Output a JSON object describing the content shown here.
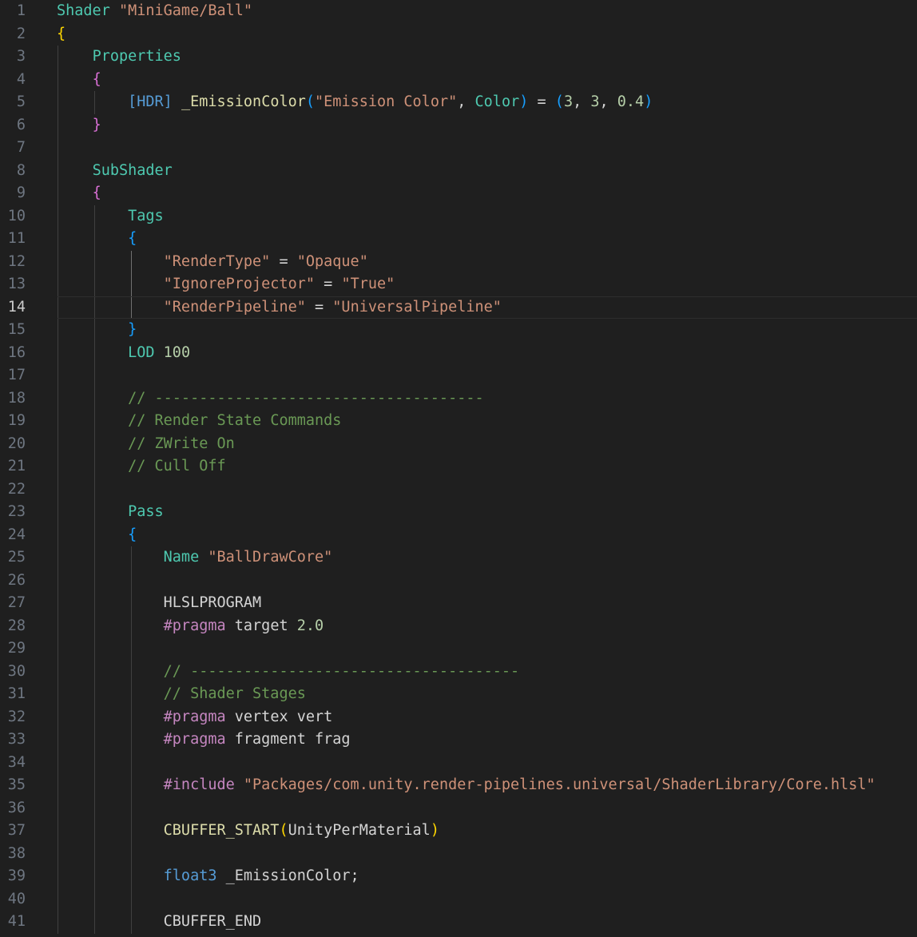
{
  "editor": {
    "language": "shaderlab",
    "current_line": 14,
    "lines": [
      {
        "n": "1",
        "tokens": [
          {
            "c": "kw",
            "t": "Shader"
          },
          {
            "c": "plain",
            "t": " "
          },
          {
            "c": "str",
            "t": "\"MiniGame/Ball\""
          }
        ]
      },
      {
        "n": "2",
        "tokens": [
          {
            "c": "b1",
            "t": "{"
          }
        ]
      },
      {
        "n": "3",
        "tokens": [
          {
            "c": "plain",
            "t": "    "
          },
          {
            "c": "kw",
            "t": "Properties"
          }
        ]
      },
      {
        "n": "4",
        "tokens": [
          {
            "c": "plain",
            "t": "    "
          },
          {
            "c": "b2",
            "t": "{"
          }
        ]
      },
      {
        "n": "5",
        "tokens": [
          {
            "c": "plain",
            "t": "        "
          },
          {
            "c": "type",
            "t": "[HDR]"
          },
          {
            "c": "plain",
            "t": " "
          },
          {
            "c": "prop",
            "t": "_EmissionColor"
          },
          {
            "c": "b3",
            "t": "("
          },
          {
            "c": "str",
            "t": "\"Emission Color\""
          },
          {
            "c": "plain",
            "t": ", "
          },
          {
            "c": "kw",
            "t": "Color"
          },
          {
            "c": "b3",
            "t": ")"
          },
          {
            "c": "plain",
            "t": " = "
          },
          {
            "c": "b3",
            "t": "("
          },
          {
            "c": "num",
            "t": "3"
          },
          {
            "c": "plain",
            "t": ", "
          },
          {
            "c": "num",
            "t": "3"
          },
          {
            "c": "plain",
            "t": ", "
          },
          {
            "c": "num",
            "t": "0.4"
          },
          {
            "c": "b3",
            "t": ")"
          }
        ]
      },
      {
        "n": "6",
        "tokens": [
          {
            "c": "plain",
            "t": "    "
          },
          {
            "c": "b2",
            "t": "}"
          }
        ]
      },
      {
        "n": "7",
        "tokens": []
      },
      {
        "n": "8",
        "tokens": [
          {
            "c": "plain",
            "t": "    "
          },
          {
            "c": "kw",
            "t": "SubShader"
          }
        ]
      },
      {
        "n": "9",
        "tokens": [
          {
            "c": "plain",
            "t": "    "
          },
          {
            "c": "b2",
            "t": "{"
          }
        ]
      },
      {
        "n": "10",
        "tokens": [
          {
            "c": "plain",
            "t": "        "
          },
          {
            "c": "kw",
            "t": "Tags"
          }
        ]
      },
      {
        "n": "11",
        "tokens": [
          {
            "c": "plain",
            "t": "        "
          },
          {
            "c": "b3",
            "t": "{"
          }
        ]
      },
      {
        "n": "12",
        "tokens": [
          {
            "c": "plain",
            "t": "            "
          },
          {
            "c": "str",
            "t": "\"RenderType\""
          },
          {
            "c": "plain",
            "t": " = "
          },
          {
            "c": "str",
            "t": "\"Opaque\""
          }
        ]
      },
      {
        "n": "13",
        "tokens": [
          {
            "c": "plain",
            "t": "            "
          },
          {
            "c": "str",
            "t": "\"IgnoreProjector\""
          },
          {
            "c": "plain",
            "t": " = "
          },
          {
            "c": "str",
            "t": "\"True\""
          }
        ]
      },
      {
        "n": "14",
        "tokens": [
          {
            "c": "plain",
            "t": "            "
          },
          {
            "c": "str",
            "t": "\"RenderPipeline\""
          },
          {
            "c": "plain",
            "t": " = "
          },
          {
            "c": "str",
            "t": "\"UniversalPipeline\""
          }
        ]
      },
      {
        "n": "15",
        "tokens": [
          {
            "c": "plain",
            "t": "        "
          },
          {
            "c": "b3",
            "t": "}"
          }
        ]
      },
      {
        "n": "16",
        "tokens": [
          {
            "c": "plain",
            "t": "        "
          },
          {
            "c": "kw",
            "t": "LOD"
          },
          {
            "c": "plain",
            "t": " "
          },
          {
            "c": "num",
            "t": "100"
          }
        ]
      },
      {
        "n": "17",
        "tokens": []
      },
      {
        "n": "18",
        "tokens": [
          {
            "c": "plain",
            "t": "        "
          },
          {
            "c": "cmt",
            "t": "// -------------------------------------"
          }
        ]
      },
      {
        "n": "19",
        "tokens": [
          {
            "c": "plain",
            "t": "        "
          },
          {
            "c": "cmt",
            "t": "// Render State Commands"
          }
        ]
      },
      {
        "n": "20",
        "tokens": [
          {
            "c": "plain",
            "t": "        "
          },
          {
            "c": "cmt",
            "t": "// ZWrite On"
          }
        ]
      },
      {
        "n": "21",
        "tokens": [
          {
            "c": "plain",
            "t": "        "
          },
          {
            "c": "cmt",
            "t": "// Cull Off"
          }
        ]
      },
      {
        "n": "22",
        "tokens": []
      },
      {
        "n": "23",
        "tokens": [
          {
            "c": "plain",
            "t": "        "
          },
          {
            "c": "kw",
            "t": "Pass"
          }
        ]
      },
      {
        "n": "24",
        "tokens": [
          {
            "c": "plain",
            "t": "        "
          },
          {
            "c": "b3",
            "t": "{"
          }
        ]
      },
      {
        "n": "25",
        "tokens": [
          {
            "c": "plain",
            "t": "            "
          },
          {
            "c": "kw",
            "t": "Name"
          },
          {
            "c": "plain",
            "t": " "
          },
          {
            "c": "str",
            "t": "\"BallDrawCore\""
          }
        ]
      },
      {
        "n": "26",
        "tokens": []
      },
      {
        "n": "27",
        "tokens": [
          {
            "c": "plain",
            "t": "            "
          },
          {
            "c": "id",
            "t": "HLSLPROGRAM"
          }
        ]
      },
      {
        "n": "28",
        "tokens": [
          {
            "c": "plain",
            "t": "            "
          },
          {
            "c": "pp",
            "t": "#pragma"
          },
          {
            "c": "plain",
            "t": " target "
          },
          {
            "c": "num",
            "t": "2.0"
          }
        ]
      },
      {
        "n": "29",
        "tokens": []
      },
      {
        "n": "30",
        "tokens": [
          {
            "c": "plain",
            "t": "            "
          },
          {
            "c": "cmt",
            "t": "// -------------------------------------"
          }
        ]
      },
      {
        "n": "31",
        "tokens": [
          {
            "c": "plain",
            "t": "            "
          },
          {
            "c": "cmt",
            "t": "// Shader Stages"
          }
        ]
      },
      {
        "n": "32",
        "tokens": [
          {
            "c": "plain",
            "t": "            "
          },
          {
            "c": "pp",
            "t": "#pragma"
          },
          {
            "c": "plain",
            "t": " vertex vert"
          }
        ]
      },
      {
        "n": "33",
        "tokens": [
          {
            "c": "plain",
            "t": "            "
          },
          {
            "c": "pp",
            "t": "#pragma"
          },
          {
            "c": "plain",
            "t": " fragment frag"
          }
        ]
      },
      {
        "n": "34",
        "tokens": []
      },
      {
        "n": "35",
        "tokens": [
          {
            "c": "plain",
            "t": "            "
          },
          {
            "c": "pp",
            "t": "#include"
          },
          {
            "c": "plain",
            "t": " "
          },
          {
            "c": "str",
            "t": "\"Packages/com.unity.render-pipelines.universal/ShaderLibrary/Core.hlsl\""
          }
        ]
      },
      {
        "n": "36",
        "tokens": []
      },
      {
        "n": "37",
        "tokens": [
          {
            "c": "plain",
            "t": "            "
          },
          {
            "c": "prop",
            "t": "CBUFFER_START"
          },
          {
            "c": "b1",
            "t": "("
          },
          {
            "c": "id",
            "t": "UnityPerMaterial"
          },
          {
            "c": "b1",
            "t": ")"
          }
        ]
      },
      {
        "n": "38",
        "tokens": []
      },
      {
        "n": "39",
        "tokens": [
          {
            "c": "plain",
            "t": "            "
          },
          {
            "c": "type",
            "t": "float3"
          },
          {
            "c": "plain",
            "t": " _EmissionColor;"
          }
        ]
      },
      {
        "n": "40",
        "tokens": []
      },
      {
        "n": "41",
        "tokens": [
          {
            "c": "plain",
            "t": "            "
          },
          {
            "c": "id",
            "t": "CBUFFER_END"
          }
        ]
      }
    ]
  }
}
